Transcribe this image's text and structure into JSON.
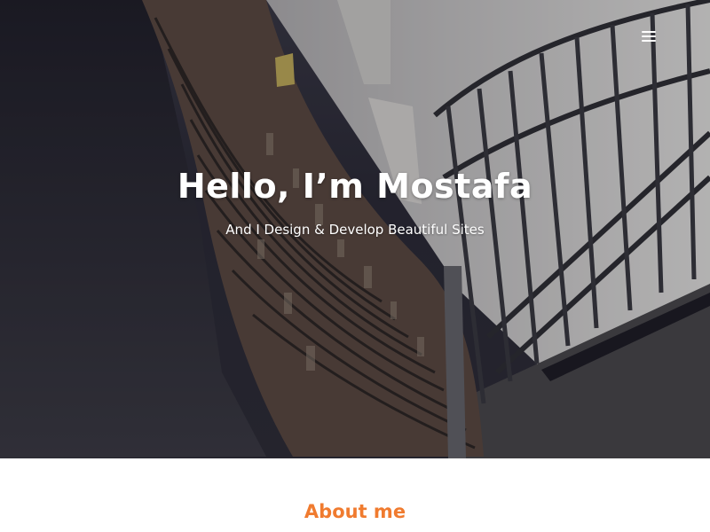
{
  "hero": {
    "title": "Hello, I’m Mostafa",
    "subtitle": "And I Design & Develop Beautiful Sites",
    "menu_icon": "hamburger-menu-icon"
  },
  "about": {
    "heading": "About me"
  },
  "colors": {
    "accent": "#f07b2f",
    "hero_text": "#ffffff",
    "background": "#ffffff"
  }
}
